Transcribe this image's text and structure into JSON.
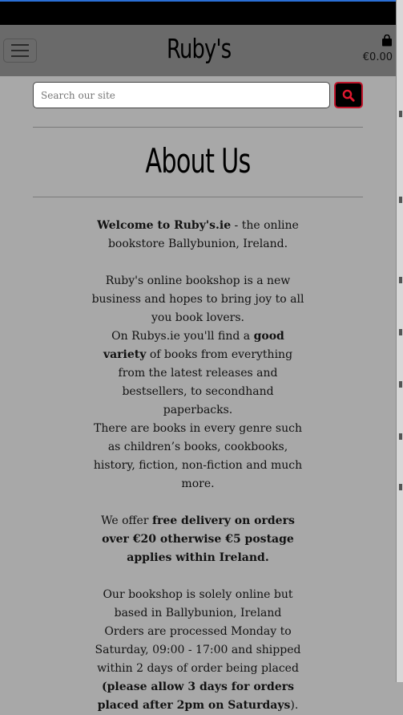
{
  "header": {
    "logo": "Ruby's",
    "cart_total": "€0.00",
    "menu_icon": "hamburger-icon",
    "cart_icon": "shopping-bag-icon"
  },
  "search": {
    "placeholder": "Search our site",
    "icon": "search-icon"
  },
  "page": {
    "title": "About Us"
  },
  "about": {
    "p1_bold": "Welcome to Ruby's.ie",
    "p1_rest": " - the online bookstore Ballybunion, Ireland.",
    "p2": "Ruby's online bookshop is a new business and hopes to bring joy to all you book lovers.",
    "p3_pre": "On Rubys.ie you'll find a ",
    "p3_bold": "good variety",
    "p3_post": " of books from everything from the latest releases and bestsellers, to secondhand paperbacks.",
    "p4": "There are books in every genre such as children’s books, cookbooks, history, fiction, non-fiction and much more.",
    "p5_pre": "We offer ",
    "p5_bold": "free delivery on orders over €20 otherwise €5 postage applies within Ireland.",
    "p6": "Our bookshop is solely online but based in Ballybunion, Ireland",
    "p7": "Orders are processed Monday to Saturday, 09:00 - 17:00 and shipped within 2 days of order being placed",
    "p8_bold": "(please allow 3 days for orders placed after 2pm on Saturdays",
    "p8_post": ")."
  },
  "colors": {
    "overlay_bg": "#a8a8a8",
    "navbar_bg": "#6a6a6a",
    "search_button_bg": "#000000",
    "search_button_border": "#c0152b",
    "search_icon": "#e0182f"
  }
}
